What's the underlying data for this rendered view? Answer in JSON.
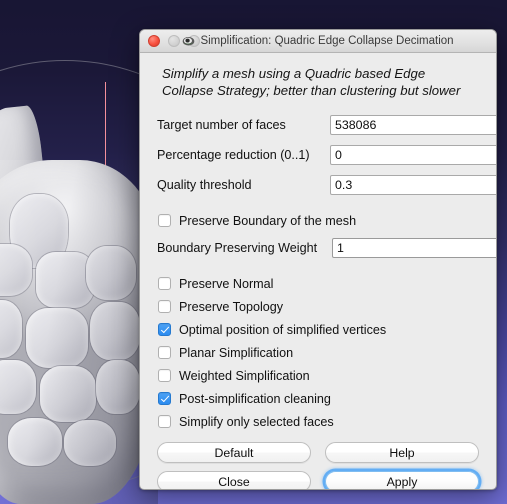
{
  "window": {
    "title": "Simplification: Quadric Edge Collapse Decimation",
    "app_icon": "meshlab-icon",
    "traffic_lights": {
      "close": "close-button",
      "minimize": "minimize-button",
      "maximize": "maximize-button"
    }
  },
  "description": "Simplify a mesh using a Quadric based Edge Collapse Strategy; better than clustering but slower",
  "fields": [
    {
      "label": "Target number of faces",
      "value": "538086",
      "name": "target-number-of-faces"
    },
    {
      "label": "Percentage reduction (0..1)",
      "value": "0",
      "name": "percentage-reduction"
    },
    {
      "label": "Quality threshold",
      "value": "0.3",
      "name": "quality-threshold"
    }
  ],
  "boundary_weight": {
    "label": "Boundary Preserving Weight",
    "value": "1",
    "name": "boundary-preserving-weight"
  },
  "checkboxes": [
    {
      "label": "Preserve Boundary of the mesh",
      "checked": false,
      "name": "preserve-boundary"
    },
    {
      "label": "Preserve Normal",
      "checked": false,
      "name": "preserve-normal"
    },
    {
      "label": "Preserve Topology",
      "checked": false,
      "name": "preserve-topology"
    },
    {
      "label": "Optimal position of simplified vertices",
      "checked": true,
      "name": "optimal-position"
    },
    {
      "label": "Planar Simplification",
      "checked": false,
      "name": "planar-simplification"
    },
    {
      "label": "Weighted Simplification",
      "checked": false,
      "name": "weighted-simplification"
    },
    {
      "label": "Post-simplification cleaning",
      "checked": true,
      "name": "post-simplification-cleaning"
    },
    {
      "label": "Simplify only selected faces",
      "checked": false,
      "name": "simplify-only-selected-faces"
    }
  ],
  "buttons": {
    "default": "Default",
    "help": "Help",
    "close": "Close",
    "apply": "Apply"
  },
  "colors": {
    "accent": "#2b8bef",
    "focus_ring": "#50a5f5",
    "dialog_bg": "#ececec",
    "close_light": "#f8513f",
    "viewport_top": "#16133 1",
    "viewport_bottom": "#6f6dd4",
    "axis_vertical": "#ff96a0",
    "axis_horizontal": "#96eb96"
  },
  "viewport": {
    "name": "3d-mesh-viewport",
    "object": "scanned-mesh-model"
  }
}
